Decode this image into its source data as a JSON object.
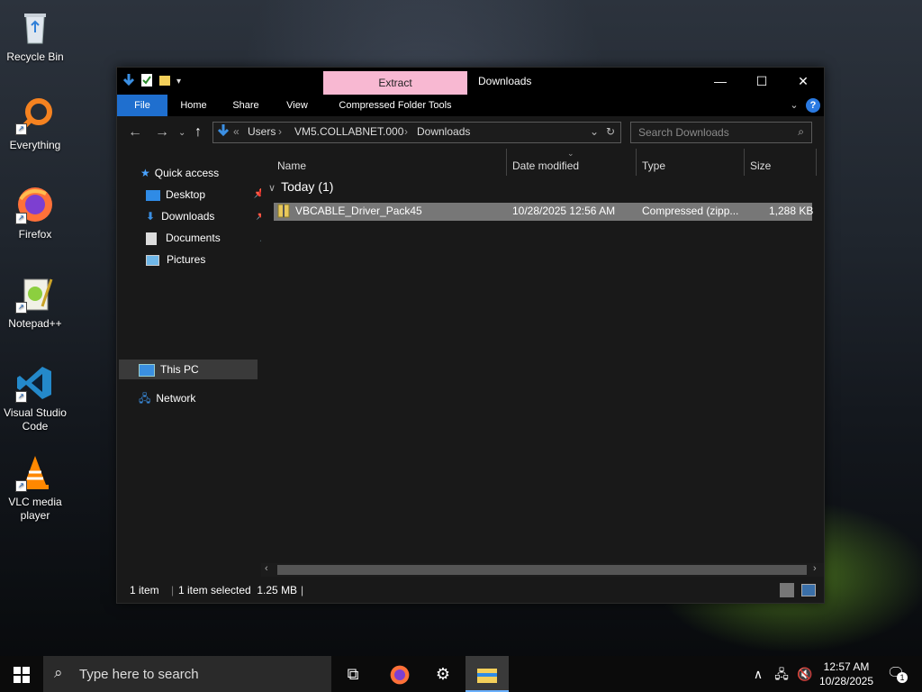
{
  "desktop": {
    "icons": [
      {
        "label": "Recycle Bin",
        "icon": "recycle-bin-icon"
      },
      {
        "label": "Everything",
        "icon": "everything-icon"
      },
      {
        "label": "Firefox",
        "icon": "firefox-icon"
      },
      {
        "label": "Notepad++",
        "icon": "notepad-plus-plus-icon"
      },
      {
        "label": "Visual Studio Code",
        "icon": "vscode-icon"
      },
      {
        "label": "VLC media player",
        "icon": "vlc-icon"
      }
    ]
  },
  "window": {
    "title": "Downloads",
    "contextual_tab": "Extract",
    "ribbon_tabs": [
      "File",
      "Home",
      "Share",
      "View",
      "Compressed Folder Tools"
    ],
    "breadcrumb": [
      "Users",
      "VM5.COLLABNET.000",
      "Downloads"
    ],
    "breadcrumb_overflow": "«",
    "search_placeholder": "Search Downloads",
    "nav": {
      "quick_access": "Quick access",
      "items": [
        {
          "label": "Desktop",
          "pinned": true
        },
        {
          "label": "Downloads",
          "pinned": true
        },
        {
          "label": "Documents",
          "pinned": true
        },
        {
          "label": "Pictures",
          "pinned": true
        }
      ],
      "this_pc": "This PC",
      "network": "Network"
    },
    "columns": [
      "Name",
      "Date modified",
      "Type",
      "Size"
    ],
    "group_label": "Today (1)",
    "files": [
      {
        "name": "VBCABLE_Driver_Pack45",
        "date": "10/28/2025 12:56 AM",
        "type": "Compressed (zipp...",
        "size": "1,288 KB"
      }
    ],
    "status": {
      "items": "1 item",
      "selected": "1 item selected  1.25 MB"
    }
  },
  "taskbar": {
    "search_placeholder": "Type here to search",
    "time": "12:57 AM",
    "date": "10/28/2025",
    "notification_count": "1"
  },
  "colors": {
    "accent": "#1f6fcf",
    "context_tab": "#f8b8d2",
    "selection": "#777777"
  }
}
